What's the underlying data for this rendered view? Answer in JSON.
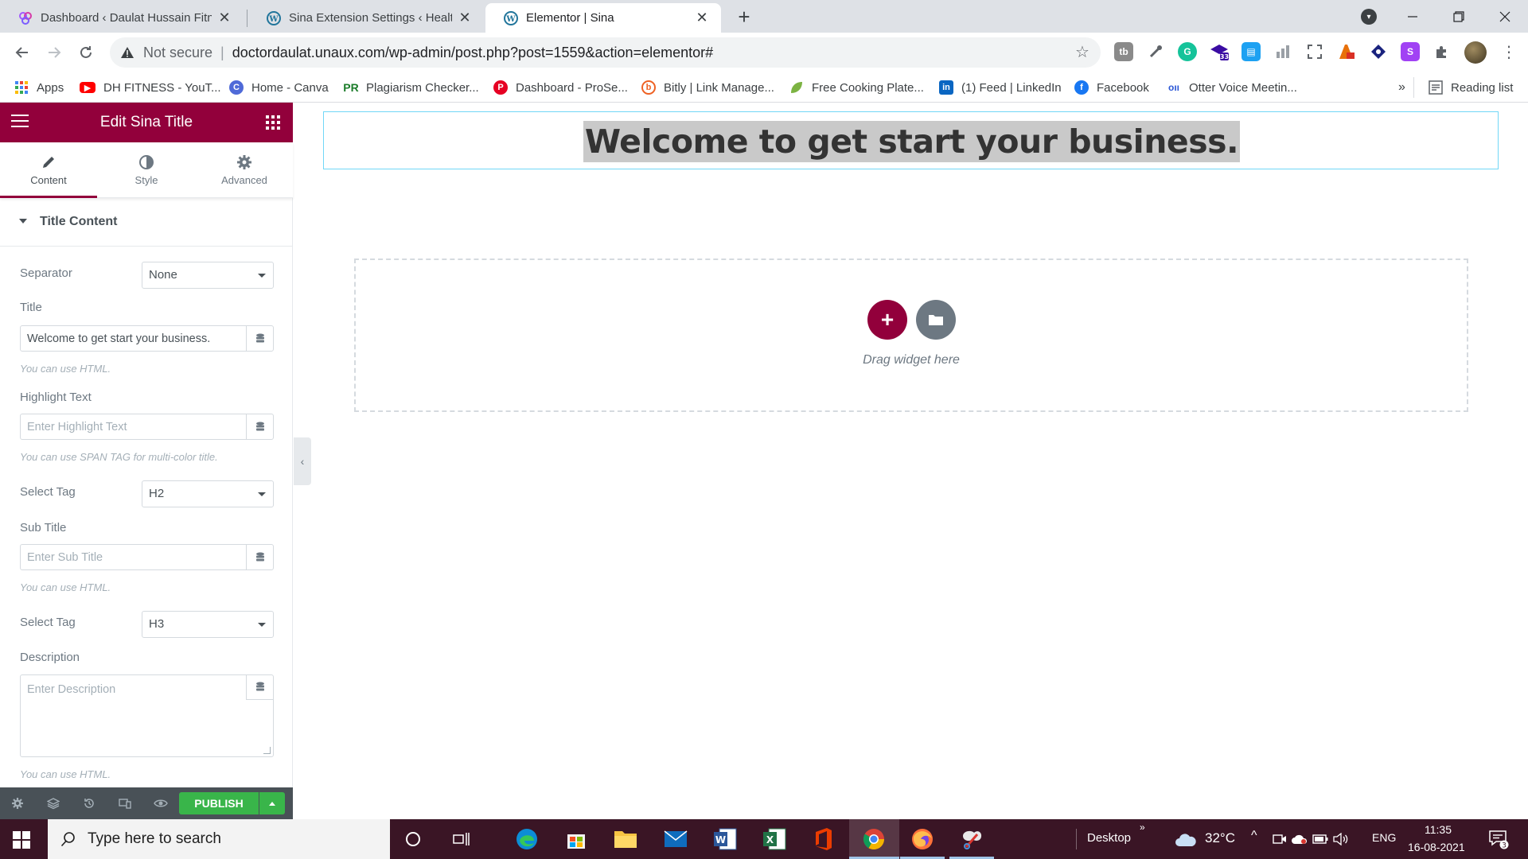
{
  "browser": {
    "tabs": [
      {
        "title": "Dashboard ‹ Daulat Hussain Fitne",
        "icon": "canva-flower-icon",
        "active": false
      },
      {
        "title": "Sina Extension Settings ‹ Health &",
        "icon": "wordpress-icon",
        "active": false
      },
      {
        "title": "Elementor | Sina",
        "icon": "wordpress-icon",
        "active": true
      }
    ],
    "new_tab": "+",
    "address": {
      "security_label": "Not secure",
      "url": "doctordaulat.unaux.com/wp-admin/post.php?post=1559&action=elementor#"
    },
    "extension_badge": "33",
    "bookmarks": [
      {
        "label": "Apps",
        "icon": "apps-grid-icon"
      },
      {
        "label": "DH FITNESS - YouT...",
        "icon": "youtube-icon"
      },
      {
        "label": "Home - Canva",
        "icon": "canva-icon"
      },
      {
        "label": "Plagiarism Checker...",
        "icon": "prepostseo-icon"
      },
      {
        "label": "Dashboard - ProSe...",
        "icon": "pinterest-icon"
      },
      {
        "label": "Bitly | Link Manage...",
        "icon": "bitly-icon"
      },
      {
        "label": "Free Cooking Plate...",
        "icon": "leaf-icon"
      },
      {
        "label": "(1) Feed | LinkedIn",
        "icon": "linkedin-icon"
      },
      {
        "label": "Facebook",
        "icon": "facebook-icon"
      },
      {
        "label": "Otter Voice Meetin...",
        "icon": "otter-icon"
      }
    ],
    "bookmarks_overflow": "»",
    "reading_list": "Reading list"
  },
  "panel": {
    "title": "Edit Sina Title",
    "tabs": [
      {
        "label": "Content",
        "icon": "pencil-icon"
      },
      {
        "label": "Style",
        "icon": "half-circle-icon"
      },
      {
        "label": "Advanced",
        "icon": "gear-icon"
      }
    ],
    "section": "Title Content",
    "fields": {
      "separator": {
        "label": "Separator",
        "value": "None"
      },
      "title": {
        "label": "Title",
        "value": "Welcome to get start your business.",
        "note": "You can use HTML."
      },
      "highlight": {
        "label": "Highlight Text",
        "placeholder": "Enter Highlight Text",
        "note": "You can use SPAN TAG for multi-color title."
      },
      "select_tag_1": {
        "label": "Select Tag",
        "value": "H2"
      },
      "sub_title": {
        "label": "Sub Title",
        "placeholder": "Enter Sub Title",
        "note": "You can use HTML."
      },
      "select_tag_2": {
        "label": "Select Tag",
        "value": "H3"
      },
      "description": {
        "label": "Description",
        "placeholder": "Enter Description",
        "note": "You can use HTML."
      }
    },
    "footer": {
      "publish_label": "PUBLISH"
    }
  },
  "canvas": {
    "headline": "Welcome to get start your business.",
    "drop_text": "Drag widget here",
    "add_symbol": "+"
  },
  "taskbar": {
    "search_placeholder": "Type here to search",
    "desktop_label": "Desktop",
    "desktop_chevron": "»",
    "temperature": "32°C",
    "language": "ENG",
    "time": "11:35",
    "date": "16-08-2021",
    "notification_count": "3"
  },
  "colors": {
    "elementor_brand": "#92003b",
    "publish_green": "#39b54a",
    "taskbar": "#3a1525",
    "selection_outline": "#71d7f7"
  }
}
